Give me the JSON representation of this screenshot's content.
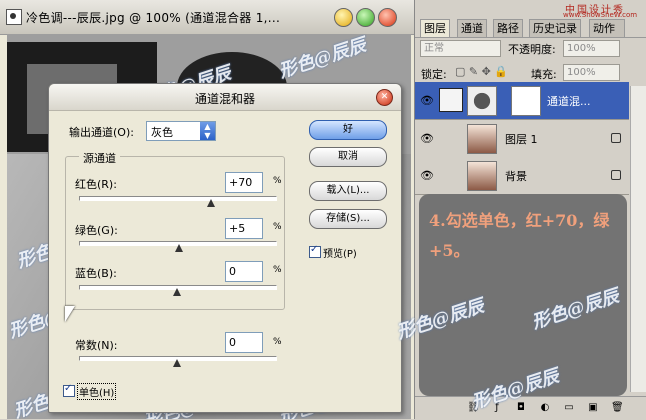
{
  "document": {
    "title": "冷色调---辰辰.jpg @ 100% (通道混合器 1,..."
  },
  "watermark": "形色@辰辰",
  "dialog": {
    "title": "通道混和器",
    "output_label": "输出通道(O):",
    "output_value": "灰色",
    "source_group": "源通道",
    "red_label": "红色(R):",
    "red_value": "+70",
    "red_level": 70,
    "green_label": "绿色(G):",
    "green_value": "+5",
    "green_level": 5,
    "blue_label": "蓝色(B):",
    "blue_value": "0",
    "blue_level": 0,
    "const_label": "常数(N):",
    "const_value": "0",
    "const_level": 0,
    "percent": "%",
    "mono_label": "单色(H)",
    "mono_checked": true,
    "ok": "好",
    "cancel": "取消",
    "load": "载入(L)...",
    "save": "存储(S)...",
    "preview": "预览(P)",
    "preview_checked": true
  },
  "panel": {
    "tabs": [
      "图层",
      "通道",
      "路径",
      "历史记录",
      "动作"
    ],
    "site_top": "中国设计秀",
    "site_sub": "www.ShowSheW.com",
    "blend_mode": "正常",
    "opacity_label": "不透明度:",
    "opacity_value": "100%",
    "lock_label": "锁定:",
    "fill_label": "填充:",
    "fill_value": "100%",
    "layers": [
      {
        "name": "通道混...",
        "selected": true
      },
      {
        "name": "图层 1",
        "selected": false
      },
      {
        "name": "背景",
        "selected": false
      }
    ],
    "note": "4.勾选单色，红+70，绿+5。"
  }
}
